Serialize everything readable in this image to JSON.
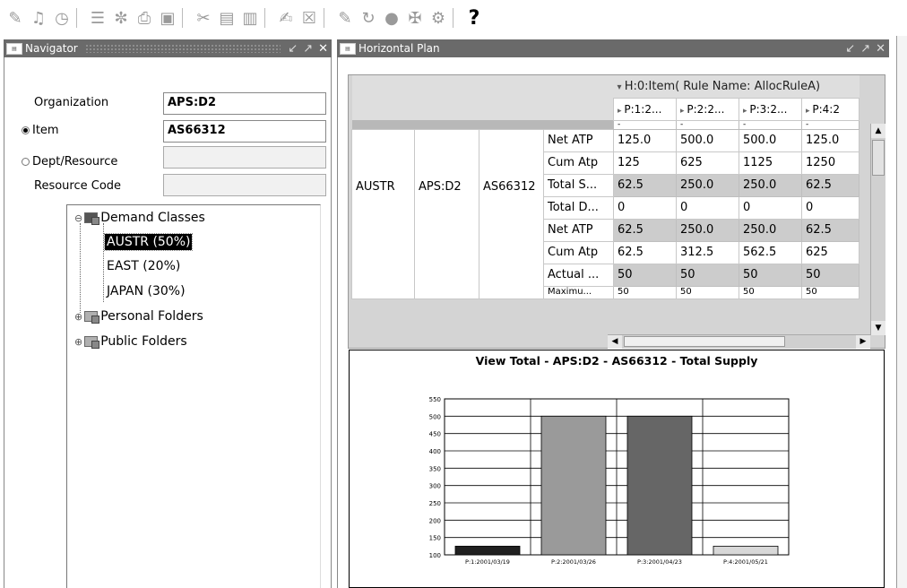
{
  "toolbar": {
    "icons": [
      "new-icon",
      "find-icon",
      "clock-icon",
      "open-icon",
      "navigate-icon",
      "print-icon",
      "save-icon",
      "cut-icon",
      "copy-icon",
      "paste-icon",
      "edit-icon",
      "clear-icon",
      "pencil-icon",
      "refresh-icon",
      "globe-icon",
      "attach-icon",
      "zoom-icon"
    ],
    "help_label": "?"
  },
  "navigator": {
    "title": "Navigator",
    "organization_label": "Organization",
    "organization_value": "APS:D2",
    "item_label": "Item",
    "item_value": "AS66312",
    "dept_label": "Dept/Resource",
    "dept_value": "",
    "resource_code_label": "Resource Code",
    "resource_code_value": "",
    "tree": {
      "root": "Demand Classes",
      "children": [
        "AUSTR (50%)",
        "EAST (20%)",
        "JAPAN (30%)"
      ],
      "personal": "Personal Folders",
      "public": "Public Folders"
    }
  },
  "plan": {
    "title": "Horizontal Plan",
    "header_main": "H:0:Item( Rule Name: AllocRuleA)",
    "periods": [
      "P:1:2...",
      "P:2:2...",
      "P:3:2...",
      "P:4:2"
    ],
    "group": {
      "demand_class": "AUSTR",
      "org": "APS:D2",
      "item": "AS66312"
    },
    "rows": [
      {
        "label": "Net ATP",
        "values": [
          "125.0",
          "500.0",
          "500.0",
          "125.0"
        ],
        "shade": "white"
      },
      {
        "label": "Cum Atp",
        "values": [
          "125",
          "625",
          "1125",
          "1250"
        ],
        "shade": "white"
      },
      {
        "label": "Total S...",
        "values": [
          "62.5",
          "250.0",
          "250.0",
          "62.5"
        ],
        "shade": "gray"
      },
      {
        "label": "Total D...",
        "values": [
          "0",
          "0",
          "0",
          "0"
        ],
        "shade": "white"
      },
      {
        "label": "Net ATP",
        "values": [
          "62.5",
          "250.0",
          "250.0",
          "62.5"
        ],
        "shade": "gray"
      },
      {
        "label": "Cum Atp",
        "values": [
          "62.5",
          "312.5",
          "562.5",
          "625"
        ],
        "shade": "white"
      },
      {
        "label": "Actual ...",
        "values": [
          "50",
          "50",
          "50",
          "50"
        ],
        "shade": "gray"
      },
      {
        "label": "Maximu...",
        "values": [
          "50",
          "50",
          "50",
          "50"
        ],
        "shade": "white"
      }
    ]
  },
  "chart_data": {
    "type": "bar",
    "title": "View Total - APS:D2 - AS66312 - Total Supply",
    "categories": [
      "P:1:2001/03/19",
      "P:2:2001/03/26",
      "P:3:2001/04/23",
      "P:4:2001/05/21"
    ],
    "values": [
      125,
      500,
      500,
      125
    ],
    "bar_colors": [
      "#202020",
      "#9a9a9a",
      "#666666",
      "#d8d8d8"
    ],
    "ylim": [
      100,
      550
    ],
    "yticks": [
      100,
      150,
      200,
      250,
      300,
      350,
      400,
      450,
      500,
      550
    ],
    "grid": true
  }
}
